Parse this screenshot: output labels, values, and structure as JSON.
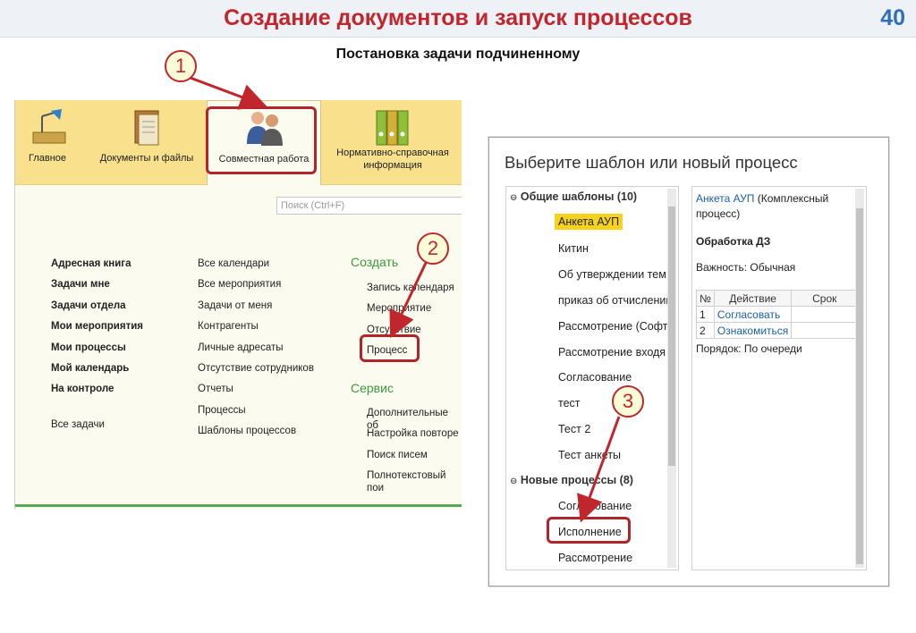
{
  "header": {
    "title": "Создание документов и запуск процессов",
    "page_number": "40"
  },
  "subtitle": "Постановка задачи подчиненному",
  "panel1": {
    "tabs": [
      {
        "label": "Главное",
        "icon": "desk-lamp-icon"
      },
      {
        "label": "Документы и файлы",
        "icon": "documents-icon"
      },
      {
        "label": "Совместная работа",
        "icon": "people-icon"
      },
      {
        "label": "Нормативно-справочная информация",
        "icon": "binders-icon"
      }
    ],
    "search_placeholder": "Поиск (Ctrl+F)",
    "col1": [
      "Адресная книга",
      "Задачи мне",
      "Задачи отдела",
      "Мои мероприятия",
      "Мои процессы",
      "Мой календарь",
      "На контроле"
    ],
    "col1_extra": "Все задачи",
    "col2": [
      "Все календари",
      "Все мероприятия",
      "Задачи от меня",
      "Контрагенты",
      "Личные адресаты",
      "Отсутствие сотрудников",
      "Отчеты",
      "Процессы",
      "Шаблоны процессов"
    ],
    "create_title": "Создать",
    "create_items": [
      "Запись календаря",
      "Мероприятие",
      "Отсутствие",
      "Процесс"
    ],
    "service_title": "Сервис",
    "service_items": [
      "Дополнительные об",
      "Настройка повторе",
      "Поиск писем",
      "Полнотекстовый пои"
    ]
  },
  "dialog": {
    "title": "Выберите шаблон или новый процесс",
    "group1": "Общие шаблоны (10)",
    "group1_items": [
      "Анкета АУП",
      "Китин",
      "Об утверждении тем",
      "приказ об отчислении",
      "Рассмотрение (СофтБ",
      "Рассмотрение входя",
      "Согласование",
      "тест",
      "Тест 2",
      "Тест анкеты"
    ],
    "group2": "Новые процессы (8)",
    "group2_items": [
      "Согласование",
      "Исполнение",
      "Рассмотрение"
    ],
    "details": {
      "link": "Анкета АУП",
      "link_suffix": " (Комплексный процесс)",
      "heading": "Обработка ДЗ",
      "importance": "Важность: Обычная",
      "table_headers": [
        "№",
        "Действие",
        "Срок"
      ],
      "rows": [
        {
          "n": "1",
          "action": "Согласовать",
          "term": ""
        },
        {
          "n": "2",
          "action": "Ознакомиться",
          "term": ""
        }
      ],
      "order": "Порядок: По очереди"
    }
  },
  "callouts": [
    "1",
    "2",
    "3"
  ],
  "colors": {
    "title_red": "#c0262c",
    "page_blue": "#2f6fbd",
    "tab_yellow": "#f8e08c",
    "section_green": "#3c9a3c",
    "selected_yellow": "#f5d21e"
  }
}
